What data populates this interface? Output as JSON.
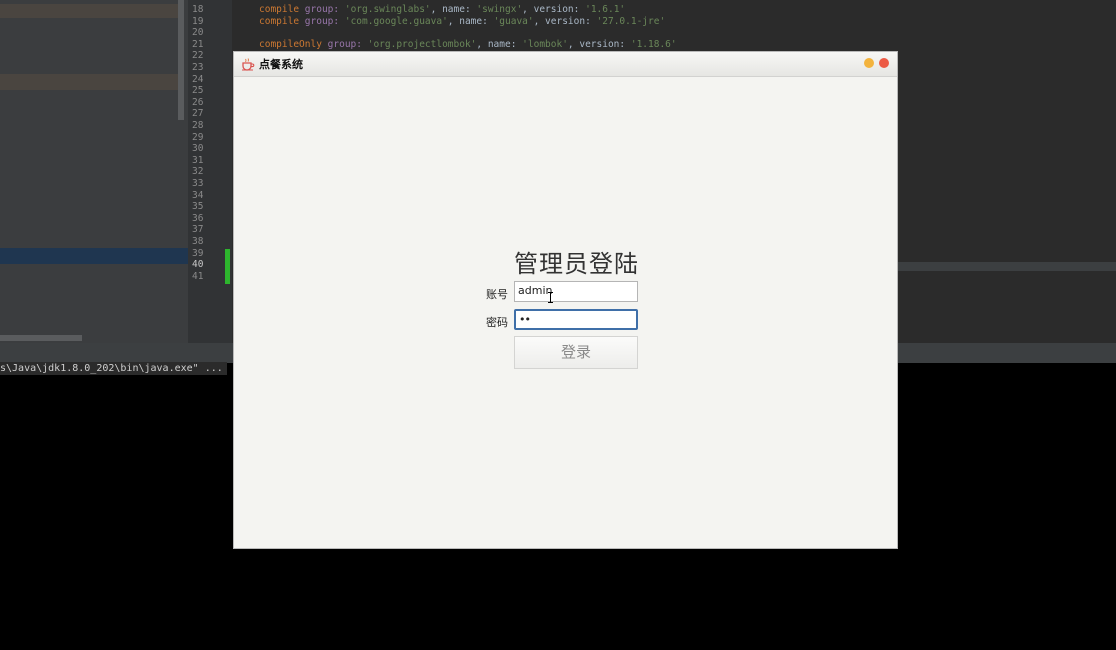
{
  "ide": {
    "line_numbers": [
      "18",
      "19",
      "20",
      "21",
      "22",
      "23",
      "24",
      "25",
      "26",
      "27",
      "28",
      "29",
      "30",
      "31",
      "32",
      "33",
      "34",
      "35",
      "36",
      "37",
      "38",
      "39",
      "40",
      "41"
    ],
    "code": {
      "line18": {
        "kw": "compile",
        "fn": "group:",
        "s1": "'org.swinglabs'",
        "mid1": ", name: ",
        "s2": "'swingx'",
        "mid2": ", version: ",
        "s3": "'1.6.1'"
      },
      "line19": {
        "kw": "compile",
        "fn": "group:",
        "s1": "'com.google.guava'",
        "mid1": ", name: ",
        "s2": "'guava'",
        "mid2": ", version: ",
        "s3": "'27.0.1-jre'"
      },
      "line21": {
        "kw": "compileOnly",
        "fn": "group:",
        "s1": "'org.projectlombok'",
        "mid1": ", name: ",
        "s2": "'lombok'",
        "mid2": ", version: ",
        "s3": "'1.18.6'"
      }
    },
    "console_text": "s\\Java\\jdk1.8.0_202\\bin\\java.exe\" ..."
  },
  "window": {
    "title": "点餐系统",
    "heading": "管理员登陆",
    "username_label": "账号",
    "username_value": "admin",
    "password_label": "密码",
    "password_value": "••",
    "login_button": "登录"
  },
  "colors": {
    "accent_focus": "#3f6fa8",
    "close_button": "#ec5a45",
    "minimize_button": "#f3b33d"
  }
}
